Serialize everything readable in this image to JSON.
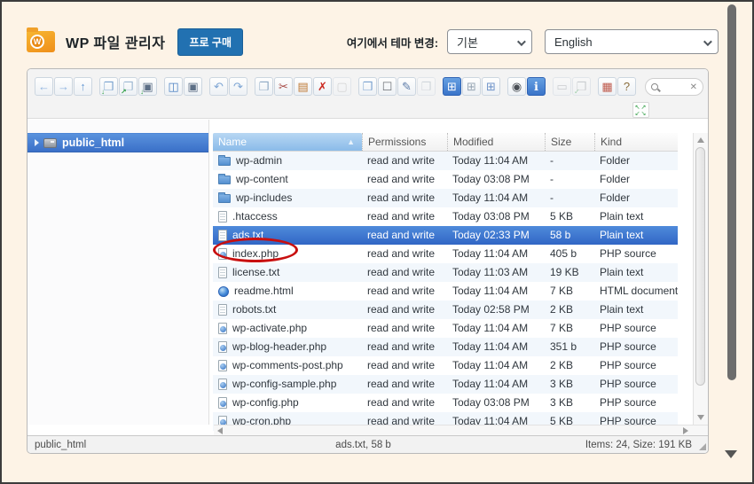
{
  "header": {
    "title": "WP 파일 관리자",
    "buy_pro_label": "프로 구매",
    "theme_change_label": "여기에서 테마 변경:",
    "theme_select_value": "기본",
    "language_select_value": "English",
    "logo_letter": "W",
    "buy_pro_color": "#2271b1"
  },
  "toolbar": {
    "search": {
      "value": "",
      "placeholder": ""
    },
    "groups": [
      {
        "items": [
          {
            "name": "back",
            "glyph": "←",
            "color": "#8fb4e0"
          },
          {
            "name": "forward",
            "glyph": "→",
            "color": "#8fb4e0"
          },
          {
            "name": "up",
            "glyph": "↑",
            "color": "#6b9cd4"
          }
        ]
      },
      {
        "items": [
          {
            "name": "download",
            "glyph": "❒",
            "color": "#7aa3cf",
            "badge": "↓"
          },
          {
            "name": "get-file",
            "glyph": "❐",
            "color": "#9db8d2",
            "badge": "↗"
          },
          {
            "name": "backup",
            "glyph": "▣",
            "color": "#5d6f86",
            "badge": "↓"
          }
        ]
      },
      {
        "items": [
          {
            "name": "open",
            "glyph": "◫",
            "color": "#4a7fc1"
          },
          {
            "name": "save",
            "glyph": "▣",
            "color": "#5d6f86"
          }
        ]
      },
      {
        "items": [
          {
            "name": "undo",
            "glyph": "↶",
            "color": "#7fa6d4"
          },
          {
            "name": "redo",
            "glyph": "↷",
            "color": "#7fa6d4"
          }
        ]
      },
      {
        "items": [
          {
            "name": "copy",
            "glyph": "❐",
            "color": "#8fa9c4"
          },
          {
            "name": "cut",
            "glyph": "✂",
            "color": "#a84a45"
          },
          {
            "name": "paste",
            "glyph": "▤",
            "color": "#bf7a36"
          },
          {
            "name": "delete",
            "glyph": "✗",
            "color": "#cc2a21"
          },
          {
            "name": "empty-folder",
            "glyph": "▢",
            "color": "#b0b0b0",
            "disabled": true
          }
        ]
      },
      {
        "items": [
          {
            "name": "duplicate",
            "glyph": "❒",
            "color": "#7ba3d0"
          },
          {
            "name": "select-all",
            "glyph": "☐",
            "color": "#6b6f74"
          },
          {
            "name": "rename",
            "glyph": "✎",
            "color": "#5b7aa8"
          },
          {
            "name": "archive",
            "glyph": "❒",
            "color": "#a7b3bf",
            "disabled": true
          }
        ]
      },
      {
        "items": [
          {
            "name": "view-list",
            "glyph": "⊞",
            "color": "#ffffff",
            "active": true
          },
          {
            "name": "view-icons",
            "glyph": "⊞",
            "color": "#98a6b4"
          },
          {
            "name": "view-compact",
            "glyph": "⊞",
            "color": "#6f93c9"
          }
        ]
      },
      {
        "items": [
          {
            "name": "toggle-hidden",
            "glyph": "◉",
            "color": "#4a4f55"
          },
          {
            "name": "info",
            "glyph": "ℹ",
            "color": "#ffffff",
            "active": true
          }
        ]
      },
      {
        "items": [
          {
            "name": "quicklook",
            "glyph": "▭",
            "color": "#9aa0a6",
            "disabled": true
          },
          {
            "name": "extract",
            "glyph": "❒",
            "color": "#9aa0a6",
            "badge": "✓",
            "disabled": true
          }
        ]
      },
      {
        "items": [
          {
            "name": "icon-size",
            "glyph": "▦",
            "color": "#bf5b4d"
          },
          {
            "name": "help",
            "glyph": "?",
            "color": "#8a6d3b"
          }
        ]
      }
    ],
    "fullscreen_arrows": [
      "↖",
      "↗",
      "↙",
      "↘"
    ]
  },
  "sidebar": {
    "items": [
      {
        "label": "public_html",
        "selected": true
      }
    ]
  },
  "table": {
    "columns": [
      "Name",
      "Permissions",
      "Modified",
      "Size",
      "Kind"
    ],
    "sort": {
      "column": "Name",
      "direction": "asc",
      "arrow": "▲"
    },
    "rows": [
      {
        "name": "wp-admin",
        "icon": "folder",
        "permissions": "read and write",
        "modified": "Today 11:04 AM",
        "size": "-",
        "kind": "Folder"
      },
      {
        "name": "wp-content",
        "icon": "folder",
        "permissions": "read and write",
        "modified": "Today 03:08 PM",
        "size": "-",
        "kind": "Folder"
      },
      {
        "name": "wp-includes",
        "icon": "folder",
        "permissions": "read and write",
        "modified": "Today 11:04 AM",
        "size": "-",
        "kind": "Folder"
      },
      {
        "name": ".htaccess",
        "icon": "text",
        "permissions": "read and write",
        "modified": "Today 03:08 PM",
        "size": "5 KB",
        "kind": "Plain text"
      },
      {
        "name": "ads.txt",
        "icon": "text",
        "permissions": "read and write",
        "modified": "Today 02:33 PM",
        "size": "58 b",
        "kind": "Plain text",
        "selected": true,
        "annotated": true
      },
      {
        "name": "index.php",
        "icon": "php",
        "permissions": "read and write",
        "modified": "Today 11:04 AM",
        "size": "405 b",
        "kind": "PHP source"
      },
      {
        "name": "license.txt",
        "icon": "text",
        "permissions": "read and write",
        "modified": "Today 11:03 AM",
        "size": "19 KB",
        "kind": "Plain text"
      },
      {
        "name": "readme.html",
        "icon": "html",
        "permissions": "read and write",
        "modified": "Today 11:04 AM",
        "size": "7 KB",
        "kind": "HTML document"
      },
      {
        "name": "robots.txt",
        "icon": "text",
        "permissions": "read and write",
        "modified": "Today 02:58 PM",
        "size": "2 KB",
        "kind": "Plain text"
      },
      {
        "name": "wp-activate.php",
        "icon": "php",
        "permissions": "read and write",
        "modified": "Today 11:04 AM",
        "size": "7 KB",
        "kind": "PHP source"
      },
      {
        "name": "wp-blog-header.php",
        "icon": "php",
        "permissions": "read and write",
        "modified": "Today 11:04 AM",
        "size": "351 b",
        "kind": "PHP source"
      },
      {
        "name": "wp-comments-post.php",
        "icon": "php",
        "permissions": "read and write",
        "modified": "Today 11:04 AM",
        "size": "2 KB",
        "kind": "PHP source"
      },
      {
        "name": "wp-config-sample.php",
        "icon": "php",
        "permissions": "read and write",
        "modified": "Today 11:04 AM",
        "size": "3 KB",
        "kind": "PHP source"
      },
      {
        "name": "wp-config.php",
        "icon": "php",
        "permissions": "read and write",
        "modified": "Today 03:08 PM",
        "size": "3 KB",
        "kind": "PHP source"
      },
      {
        "name": "wp-cron.php",
        "icon": "php",
        "permissions": "read and write",
        "modified": "Today 11:04 AM",
        "size": "5 KB",
        "kind": "PHP source"
      }
    ]
  },
  "statusbar": {
    "left": "public_html",
    "center": "ads.txt, 58 b",
    "right": "Items: 24, Size: 191 KB"
  },
  "colors": {
    "selection_blue": "#3166c5",
    "page_background": "#fdf3e6",
    "sorted_header_blue": "#8abbe9",
    "annotation_red": "#c80f0f"
  }
}
